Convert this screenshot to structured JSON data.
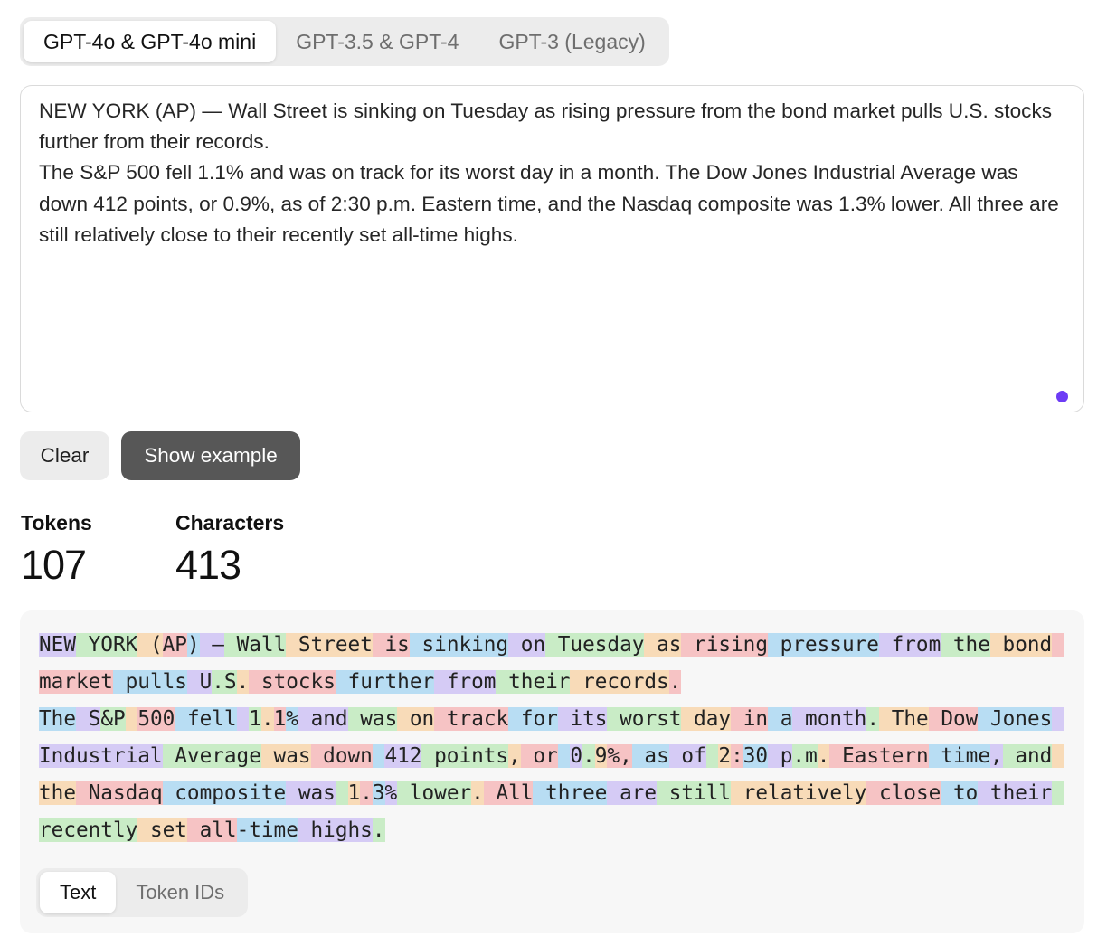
{
  "model_tabs": [
    {
      "label": "GPT-4o & GPT-4o mini",
      "active": true
    },
    {
      "label": "GPT-3.5 & GPT-4",
      "active": false
    },
    {
      "label": "GPT-3 (Legacy)",
      "active": false
    }
  ],
  "input": {
    "text": "NEW YORK (AP) — Wall Street is sinking on Tuesday as rising pressure from the bond market pulls U.S. stocks further from their records.\nThe S&P 500 fell 1.1% and was on track for its worst day in a month. The Dow Jones Industrial Average was down 412 points, or 0.9%, as of 2:30 p.m. Eastern time, and the Nasdaq composite was 1.3% lower. All three are still relatively close to their recently set all-time highs."
  },
  "buttons": {
    "clear_label": "Clear",
    "example_label": "Show example"
  },
  "stats": {
    "tokens_label": "Tokens",
    "tokens_value": "107",
    "characters_label": "Characters",
    "characters_value": "413"
  },
  "tokens": [
    "NEW",
    " YORK",
    " (",
    "AP",
    ")",
    " —",
    " Wall",
    " Street",
    " is",
    " sinking",
    " on",
    " Tuesday",
    " as",
    " rising",
    " pressure",
    " from",
    " the",
    " bond",
    " market",
    " pulls",
    " U",
    ".S",
    ".",
    " stocks",
    " further",
    " from",
    " their",
    " records",
    ".",
    "\n",
    "The",
    " S",
    "&P",
    " ",
    "500",
    " fell",
    " ",
    "1",
    ".",
    "1",
    "%",
    " and",
    " was",
    " on",
    " track",
    " for",
    " its",
    " worst",
    " day",
    " in",
    " a",
    " month",
    ".",
    " The",
    " Dow",
    " Jones",
    " Industrial",
    " Average",
    " was",
    " down",
    " ",
    "412",
    " points",
    ",",
    " or",
    " ",
    "0",
    ".",
    "9",
    "%,",
    " as",
    " of",
    " ",
    "2",
    ":",
    "30",
    " p",
    ".m",
    ".",
    " Eastern",
    " time",
    ",",
    " and",
    " the",
    " Nasdaq",
    " composite",
    " was",
    " ",
    "1",
    ".",
    "3",
    "%",
    " lower",
    ".",
    " All",
    " three",
    " are",
    " still",
    " relatively",
    " close",
    " to",
    " their",
    " recently",
    " set",
    " all",
    "-time",
    " highs",
    "."
  ],
  "token_colors": [
    "#d5cbf5",
    "#c9ecc6",
    "#f8dbb8",
    "#f6c3c4",
    "#b8ddf3"
  ],
  "view_tabs": [
    {
      "label": "Text",
      "active": true
    },
    {
      "label": "Token IDs",
      "active": false
    }
  ],
  "colors": {
    "accent_dot": "#6d3cf5",
    "example_button": "#575757"
  }
}
